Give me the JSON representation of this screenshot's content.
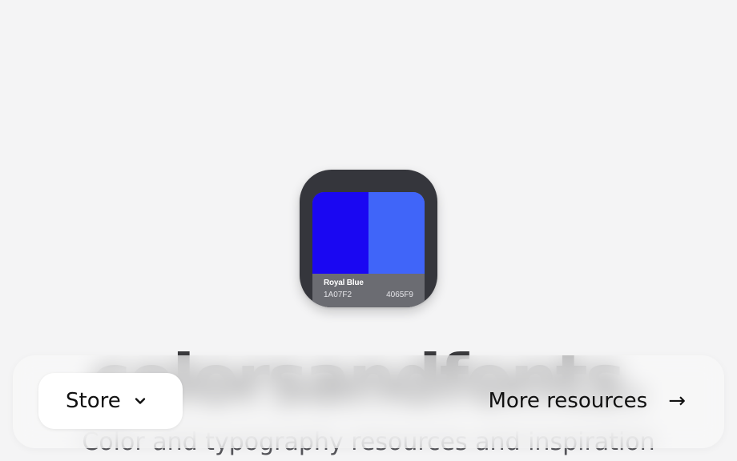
{
  "app_icon": {
    "swatch_name": "Royal Blue",
    "color_left": {
      "hex_label": "1A07F2",
      "hex": "#1A07F2"
    },
    "color_right": {
      "hex_label": "4065F9",
      "hex": "#4065F9"
    }
  },
  "hero": {
    "title": "colorsandfonts.",
    "tagline": "Color and typography resources and inspiration"
  },
  "nav_bar": {
    "store_label": "Store",
    "store_icon": "chevron-down-icon",
    "more_label": "More resources",
    "more_icon": "arrow-right-icon"
  }
}
